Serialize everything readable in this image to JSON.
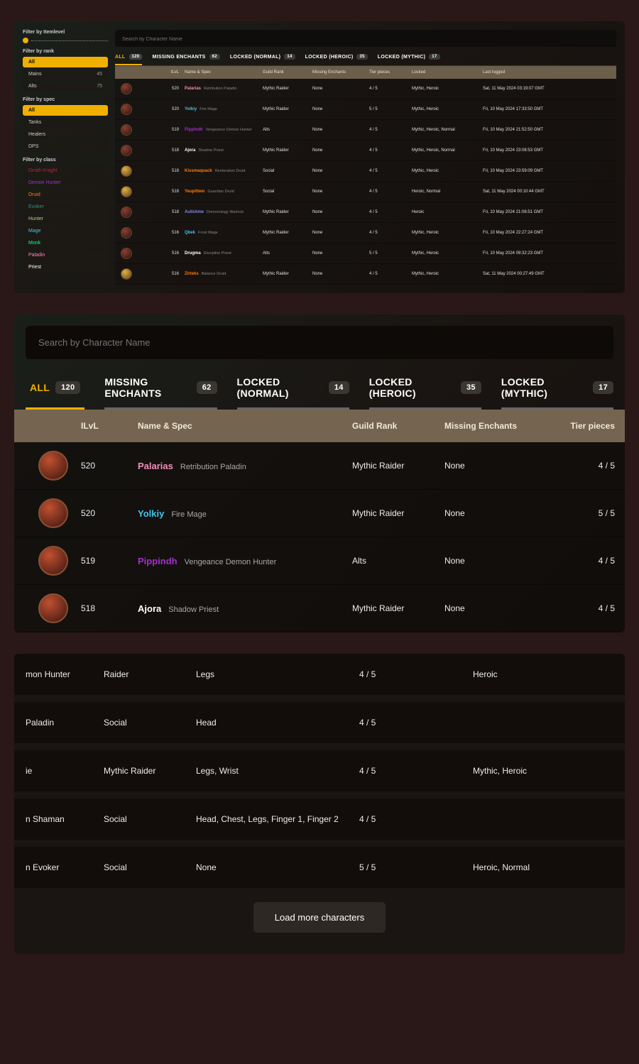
{
  "search_placeholder": "Search by Character Name",
  "sidebar": {
    "ilvl_title": "Filter by Itemlevel",
    "rank_title": "Filter by rank",
    "rank_items": [
      {
        "label": "All",
        "count": "",
        "active": true
      },
      {
        "label": "Mains",
        "count": "45"
      },
      {
        "label": "Alts",
        "count": "75"
      }
    ],
    "spec_title": "Filter by spec",
    "spec_items": [
      {
        "label": "All",
        "active": true
      },
      {
        "label": "Tanks"
      },
      {
        "label": "Healers"
      },
      {
        "label": "DPS"
      }
    ],
    "class_title": "Filter by class",
    "class_items": [
      {
        "label": "Death Knight",
        "color": "c-dk"
      },
      {
        "label": "Demon Hunter",
        "color": "c-dh"
      },
      {
        "label": "Druid",
        "color": "c-druid"
      },
      {
        "label": "Evoker",
        "color": "c-evoker"
      },
      {
        "label": "Hunter",
        "color": "c-hunter"
      },
      {
        "label": "Mage",
        "color": "c-mage"
      },
      {
        "label": "Monk",
        "color": "c-monk"
      },
      {
        "label": "Paladin",
        "color": "c-paladin"
      },
      {
        "label": "Priest",
        "color": "c-priest"
      }
    ]
  },
  "tabs": [
    {
      "label": "ALL",
      "count": "120",
      "active": true
    },
    {
      "label": "MISSING ENCHANTS",
      "count": "62"
    },
    {
      "label": "LOCKED (NORMAL)",
      "count": "14"
    },
    {
      "label": "LOCKED (HEROIC)",
      "count": "35"
    },
    {
      "label": "LOCKED (MYTHIC)",
      "count": "17"
    }
  ],
  "cols": {
    "ilvl": "ILvL",
    "name": "Name & Spec",
    "rank": "Guild Rank",
    "enchants": "Missing Enchants",
    "tier": "Tier pieces",
    "locked": "Locked",
    "logged": "Last logged"
  },
  "rows_full": [
    {
      "ilvl": "520",
      "name": "Palarias",
      "spec": "Retribution Paladin",
      "cls": "c-paladin",
      "rank": "Mythic Raider",
      "ench": "None",
      "tier": "4 / 5",
      "locked": "Mythic, Heroic",
      "logged": "Sat, 11 May 2024 03:19:07 GMT"
    },
    {
      "ilvl": "520",
      "name": "Yolkiy",
      "spec": "Fire Mage",
      "cls": "c-mage",
      "rank": "Mythic Raider",
      "ench": "None",
      "tier": "5 / 5",
      "locked": "Mythic, Heroic",
      "logged": "Fri, 10 May 2024 17:33:50 GMT"
    },
    {
      "ilvl": "519",
      "name": "Pippindh",
      "spec": "Vengeance Demon Hunter",
      "cls": "c-dh",
      "rank": "Alts",
      "ench": "None",
      "tier": "4 / 5",
      "locked": "Mythic, Heroic, Normal",
      "logged": "Fri, 10 May 2024 21:52:50 GMT"
    },
    {
      "ilvl": "518",
      "name": "Ajora",
      "spec": "Shadow Priest",
      "cls": "c-priest",
      "rank": "Mythic Raider",
      "ench": "None",
      "tier": "4 / 5",
      "locked": "Mythic, Heroic, Normal",
      "logged": "Fri, 10 May 2024 23:08:53 GMT"
    },
    {
      "ilvl": "518",
      "name": "Kissmaquack",
      "spec": "Restoration Druid",
      "cls": "c-druid",
      "rank": "Social",
      "ench": "None",
      "tier": "4 / 5",
      "locked": "Mythic, Heroic",
      "logged": "Fri, 10 May 2024 23:59:09 GMT",
      "druid": true
    },
    {
      "ilvl": "518",
      "name": "Yeupittwo",
      "spec": "Guardian Druid",
      "cls": "c-druid",
      "rank": "Social",
      "ench": "None",
      "tier": "4 / 5",
      "locked": "Heroic, Normal",
      "logged": "Sat, 11 May 2024 00:10:44 GMT",
      "druid": true
    },
    {
      "ilvl": "518",
      "name": "Autickme",
      "spec": "Demonology Warlock",
      "cls": "c-warlock",
      "rank": "Mythic Raider",
      "ench": "None",
      "tier": "4 / 5",
      "locked": "Heroic",
      "logged": "Fri, 10 May 2024 21:06:51 GMT"
    },
    {
      "ilvl": "516",
      "name": "Qbek",
      "spec": "Frost Mage",
      "cls": "c-mage",
      "rank": "Mythic Raider",
      "ench": "None",
      "tier": "4 / 5",
      "locked": "Mythic, Heroic",
      "logged": "Fri, 10 May 2024 22:27:24 GMT"
    },
    {
      "ilvl": "516",
      "name": "Drugma",
      "spec": "Discipline Priest",
      "cls": "c-priest",
      "rank": "Alts",
      "ench": "None",
      "tier": "5 / 5",
      "locked": "Mythic, Heroic",
      "logged": "Fri, 10 May 2024 09:32:23 GMT"
    },
    {
      "ilvl": "516",
      "name": "Zirteks",
      "spec": "Balance Druid",
      "cls": "c-druid",
      "rank": "Mythic Raider",
      "ench": "None",
      "tier": "4 / 5",
      "locked": "Mythic, Heroic",
      "logged": "Sat, 11 May 2024 00:27:49 GMT",
      "druid": true
    }
  ],
  "rows_zoom": [
    {
      "ilvl": "520",
      "name": "Palarias",
      "spec": "Retribution Paladin",
      "cls": "c-paladin",
      "rank": "Mythic Raider",
      "ench": "None",
      "tier": "4 / 5"
    },
    {
      "ilvl": "520",
      "name": "Yolkiy",
      "spec": "Fire Mage",
      "cls": "c-mage",
      "rank": "Mythic Raider",
      "ench": "None",
      "tier": "5 / 5"
    },
    {
      "ilvl": "519",
      "name": "Pippindh",
      "spec": "Vengeance Demon Hunter",
      "cls": "c-dh",
      "rank": "Alts",
      "ench": "None",
      "tier": "4 / 5"
    },
    {
      "ilvl": "518",
      "name": "Ajora",
      "spec": "Shadow Priest",
      "cls": "c-priest",
      "rank": "Mythic Raider",
      "ench": "None",
      "tier": "4 / 5"
    }
  ],
  "rows_scroll": [
    {
      "spec": "mon Hunter",
      "rank": "Raider",
      "ench": "Legs",
      "tier": "4 / 5",
      "locked": "Heroic"
    },
    {
      "spec": "Paladin",
      "rank": "Social",
      "ench": "Head",
      "tier": "4 / 5",
      "locked": ""
    },
    {
      "spec": "ie",
      "rank": "Mythic Raider",
      "ench": "Legs, Wrist",
      "tier": "4 / 5",
      "locked": "Mythic, Heroic"
    },
    {
      "spec": "n Shaman",
      "rank": "Social",
      "ench": "Head, Chest, Legs, Finger 1, Finger 2",
      "tier": "4 / 5",
      "locked": ""
    },
    {
      "spec": "n Evoker",
      "rank": "Social",
      "ench": "None",
      "tier": "5 / 5",
      "locked": "Heroic, Normal"
    }
  ],
  "load_more": "Load more characters"
}
